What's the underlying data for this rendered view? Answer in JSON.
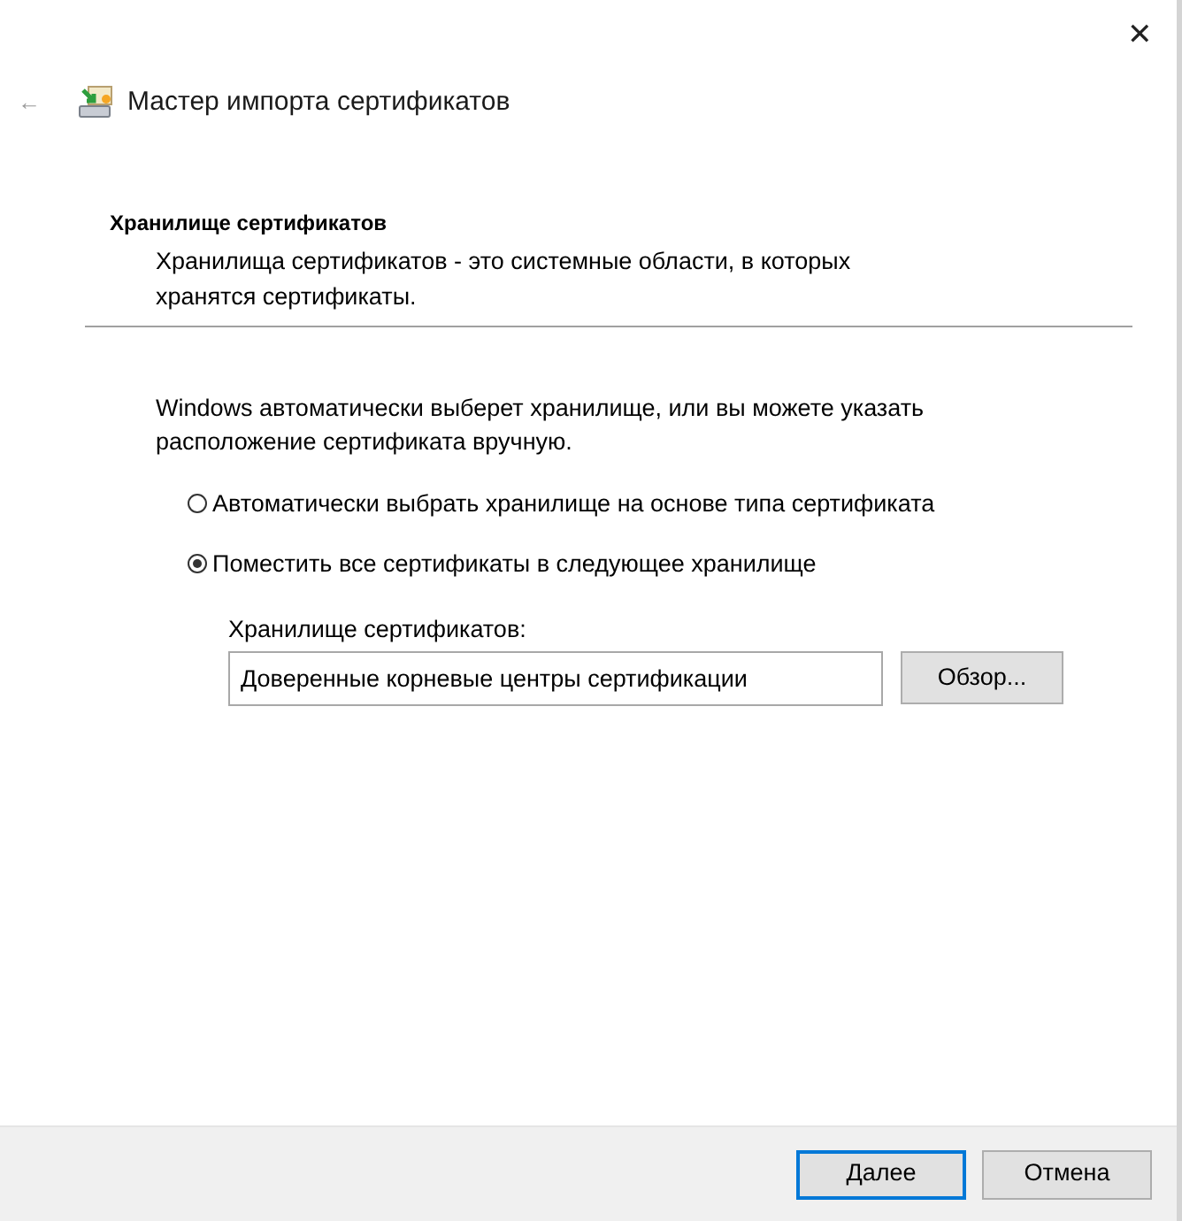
{
  "window": {
    "close": "✕",
    "back": "←",
    "title": "Мастер импорта сертификатов"
  },
  "section": {
    "heading": "Хранилище сертификатов",
    "description": "Хранилища сертификатов - это системные области, в которых хранятся сертификаты."
  },
  "intro": "Windows автоматически выберет хранилище, или вы можете указать расположение сертификата вручную.",
  "options": [
    {
      "label": "Автоматически выбрать хранилище на основе типа сертификата",
      "selected": false
    },
    {
      "label": "Поместить все сертификаты в следующее хранилище",
      "selected": true
    }
  ],
  "store": {
    "label": "Хранилище сертификатов:",
    "value": "Доверенные корневые центры сертификации",
    "browse": "Обзор..."
  },
  "buttons": [
    {
      "label": "Далее",
      "default": true
    },
    {
      "label": "Отмена",
      "default": false
    }
  ]
}
